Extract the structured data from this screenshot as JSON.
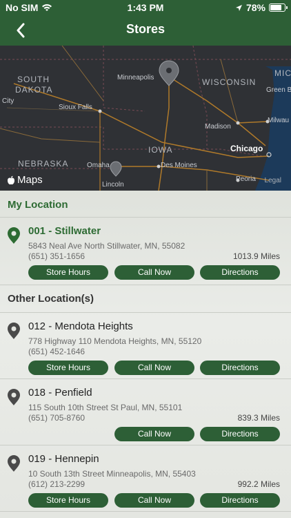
{
  "status_bar": {
    "carrier": "No SIM",
    "time": "1:43 PM",
    "battery": "78%",
    "battery_level": 0.78
  },
  "header": {
    "title": "Stores"
  },
  "map": {
    "labels": [
      {
        "name": "SOUTH",
        "kind": "state"
      },
      {
        "name": "DAKOTA",
        "kind": "state"
      },
      {
        "name": "Minneapolis",
        "kind": "city"
      },
      {
        "name": "WISCONSIN",
        "kind": "state"
      },
      {
        "name": "MIC",
        "kind": "state"
      },
      {
        "name": "Green B",
        "kind": "city"
      },
      {
        "name": "City",
        "kind": "city"
      },
      {
        "name": "Sioux Falls",
        "kind": "city"
      },
      {
        "name": "Madison",
        "kind": "city"
      },
      {
        "name": "Milwau",
        "kind": "city"
      },
      {
        "name": "IOWA",
        "kind": "state"
      },
      {
        "name": "Chicago",
        "kind": "big"
      },
      {
        "name": "NEBRASKA",
        "kind": "state"
      },
      {
        "name": "Omaha",
        "kind": "city"
      },
      {
        "name": "Des Moines",
        "kind": "city"
      },
      {
        "name": "Lincoln",
        "kind": "city"
      },
      {
        "name": "Peoria",
        "kind": "city"
      }
    ],
    "logo": "Maps",
    "legal": "Legal"
  },
  "sections": {
    "my_location": "My Location",
    "other_locations": "Other Location(s)"
  },
  "buttons": {
    "hours": "Store Hours",
    "call": "Call Now",
    "directions": "Directions"
  },
  "stores": [
    {
      "name": "001 - Stillwater",
      "address": "5843 Neal Ave North Stillwater, MN, 55082",
      "phone": "(651) 351-1656",
      "distance": "1013.9 Miles",
      "pin_color": "#2d6b33"
    },
    {
      "name": "012 - Mendota Heights",
      "address": "778 Highway 110 Mendota Heights, MN, 55120",
      "phone": "(651) 452-1646",
      "distance": "",
      "pin_color": "#4a4a4a"
    },
    {
      "name": "018 - Penfield",
      "address": "115 South 10th Street St Paul, MN, 55101",
      "phone": "(651) 705-8760",
      "distance": "839.3 Miles",
      "pin_color": "#4a4a4a"
    },
    {
      "name": "019 - Hennepin",
      "address": "10 South 13th Street Minneapolis, MN, 55403",
      "phone": "(612) 213-2299",
      "distance": "992.2 Miles",
      "pin_color": "#4a4a4a"
    }
  ],
  "colors": {
    "brand_green": "#2d5f36",
    "map_bg": "#2f3135"
  }
}
